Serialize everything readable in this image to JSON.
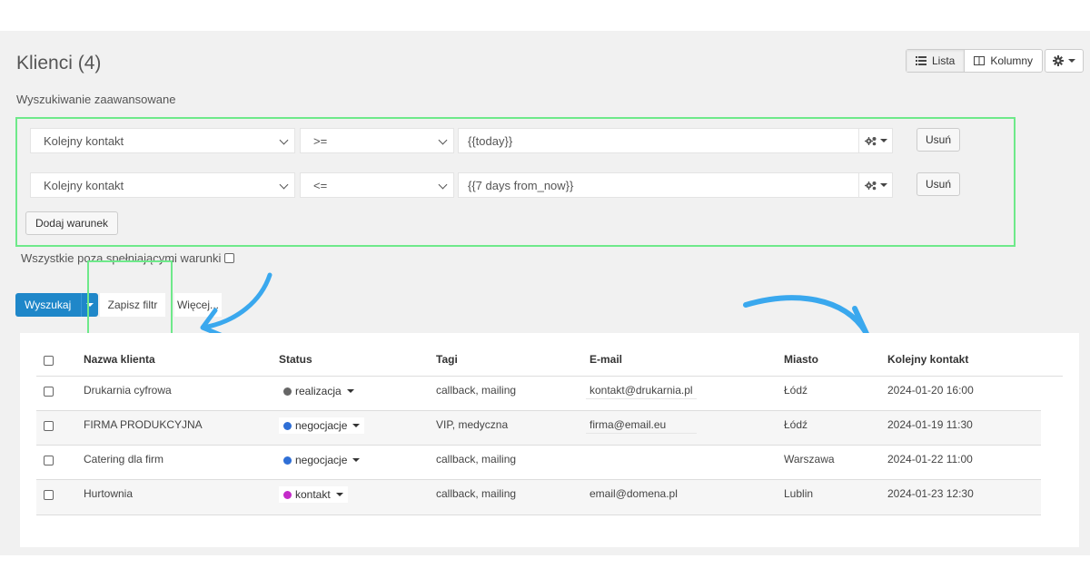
{
  "header": {
    "title": "Klienci (4)",
    "subtitle": "Wyszukiwanie zaawansowane",
    "view_list_label": "Lista",
    "view_columns_label": "Kolumny"
  },
  "filters": {
    "rows": [
      {
        "field": "Kolejny kontakt",
        "operator": ">=",
        "value": "{{today}}",
        "remove_label": "Usuń"
      },
      {
        "field": "Kolejny kontakt",
        "operator": "<=",
        "value": "{{7 days from_now}}",
        "remove_label": "Usuń"
      }
    ],
    "add_condition_label": "Dodaj warunek",
    "except_label": "Wszystkie poza spełniającymi warunki"
  },
  "actions": {
    "search_label": "Wyszukaj",
    "save_filter_label": "Zapisz filtr",
    "more_label": "Więcej..."
  },
  "table": {
    "headers": [
      "Nazwa klienta",
      "Status",
      "Tagi",
      "E-mail",
      "Miasto",
      "Kolejny kontakt"
    ],
    "rows": [
      {
        "name": "Drukarnia cyfrowa",
        "status": "realizacja",
        "tags": "callback, mailing",
        "email": "kontakt@drukarnia.pl",
        "city": "Łódź",
        "next": "2024-01-20 16:00"
      },
      {
        "name": "FIRMA PRODUKCYJNA",
        "status": "negocjacje",
        "tags": "VIP, medyczna",
        "email": "firma@email.eu",
        "city": "Łódź",
        "next": "2024-01-19 11:30"
      },
      {
        "name": "Catering dla firm",
        "status": "negocjacje",
        "tags": "callback, mailing",
        "email": "",
        "city": "Warszawa",
        "next": "2024-01-22 11:00"
      },
      {
        "name": "Hurtownia",
        "status": "kontakt",
        "tags": "callback, mailing",
        "email": "email@domena.pl",
        "city": "Lublin",
        "next": "2024-01-23 12:30"
      }
    ]
  },
  "colors": {
    "accent": "#1f87c9",
    "highlight": "#6ee98a",
    "arrow": "#3aa8ee",
    "status_realizacja": "#666666",
    "status_negocjacje": "#2f6fd6",
    "status_kontakt": "#c42bc9"
  },
  "icons": {
    "list": "list-icon",
    "columns": "columns-icon",
    "gear": "gear-icon",
    "cogs": "cogs-icon"
  }
}
